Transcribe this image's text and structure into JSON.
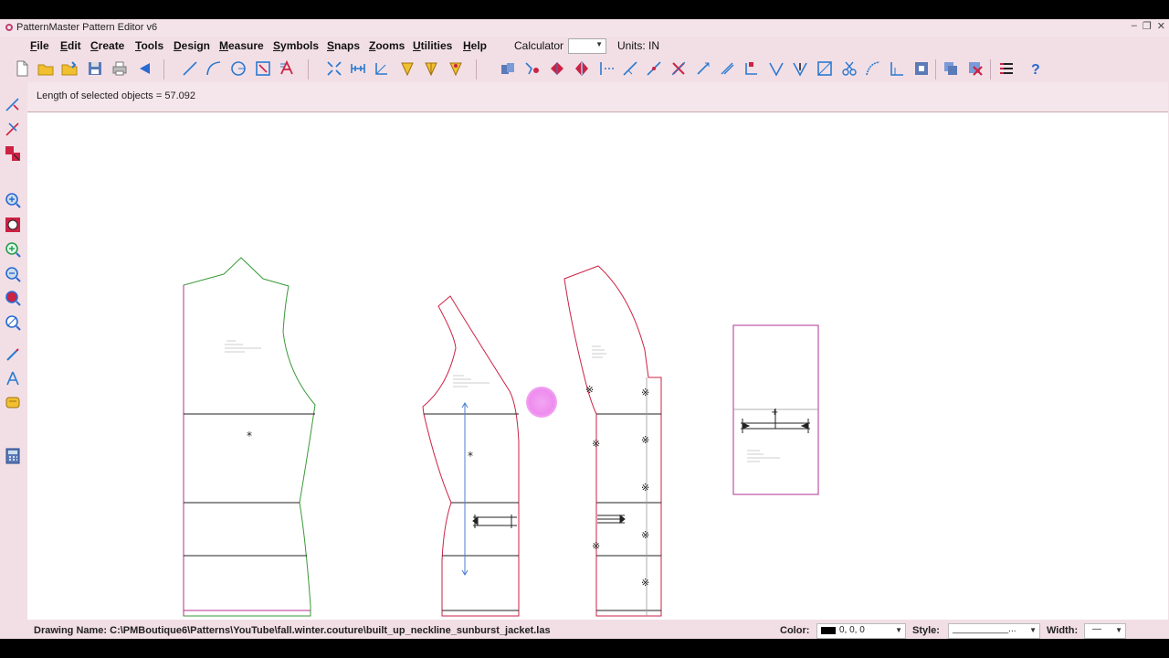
{
  "window": {
    "title": "PatternMaster Pattern Editor v6",
    "controls": [
      "–",
      "❐",
      "✕"
    ]
  },
  "menubar": {
    "items": [
      {
        "first": "F",
        "rest": "ile"
      },
      {
        "first": "E",
        "rest": "dit"
      },
      {
        "first": "C",
        "rest": "reate"
      },
      {
        "first": "T",
        "rest": "ools"
      },
      {
        "first": "D",
        "rest": "esign"
      },
      {
        "first": "M",
        "rest": "easure"
      },
      {
        "first": "S",
        "rest": "ymbols"
      },
      {
        "first": "S",
        "rest": "naps"
      },
      {
        "first": "Z",
        "rest": "ooms"
      },
      {
        "first": "U",
        "rest": "tilities"
      },
      {
        "first": "H",
        "rest": "elp"
      }
    ],
    "calculator_label": "Calculator",
    "calculator_value": "",
    "units_label": "Units: IN"
  },
  "status_message": "Length of selected objects = 57.092",
  "bottom": {
    "drawing_name": "Drawing Name: C:\\PMBoutique6\\Patterns\\YouTube\\fall.winter.couture\\built_up_neckline_sunburst_jacket.las",
    "color_label": "Color:",
    "color_value": "0, 0, 0",
    "style_label": "Style:",
    "style_value": "___________...",
    "width_label": "Width:",
    "width_value": "—"
  },
  "colors": {
    "app_bg": "#f2dfe6",
    "piece1_outline": "#3a9a3a",
    "piece_outline": "#cc2244",
    "rect_outline": "#b03090",
    "grainline": "#4a7fd0",
    "cursor": "#ee8cee"
  },
  "icons": {
    "toolbar": [
      "new-file-icon",
      "open-folder-icon",
      "open-folder-2-icon",
      "save-icon",
      "print-icon",
      "back-arrow-icon",
      "line-icon",
      "arc-icon",
      "circle-icon",
      "select-box-icon",
      "text-icon",
      "fit-icon",
      "measure-icon",
      "angle-icon",
      "pencil-yellow-icon",
      "pencil-yellow-2-icon",
      "pencil-pin-icon",
      "copy-icon",
      "mirror-icon",
      "rotate-icon",
      "flip-icon",
      "dash-line-icon",
      "cut-line-icon",
      "x-mark-icon",
      "extend-line-icon",
      "slash-icon",
      "notch-icon",
      "dart-icon",
      "dart-2-icon",
      "seam-icon",
      "scissors-icon",
      "curve-icon",
      "grade-icon",
      "layer-icon",
      "stack-icon",
      "delete-icon",
      "list-icon",
      "help-icon"
    ],
    "left": [
      "select-arrow-icon",
      "select-arrow-2-icon",
      "select-red-icon",
      "zoom-in-icon",
      "zoom-box-icon",
      "zoom-plus-icon",
      "zoom-minus-icon",
      "zoom-red-icon",
      "zoom-all-icon",
      "pencil-icon",
      "compass-icon",
      "tape-icon",
      "calculator-icon"
    ]
  }
}
